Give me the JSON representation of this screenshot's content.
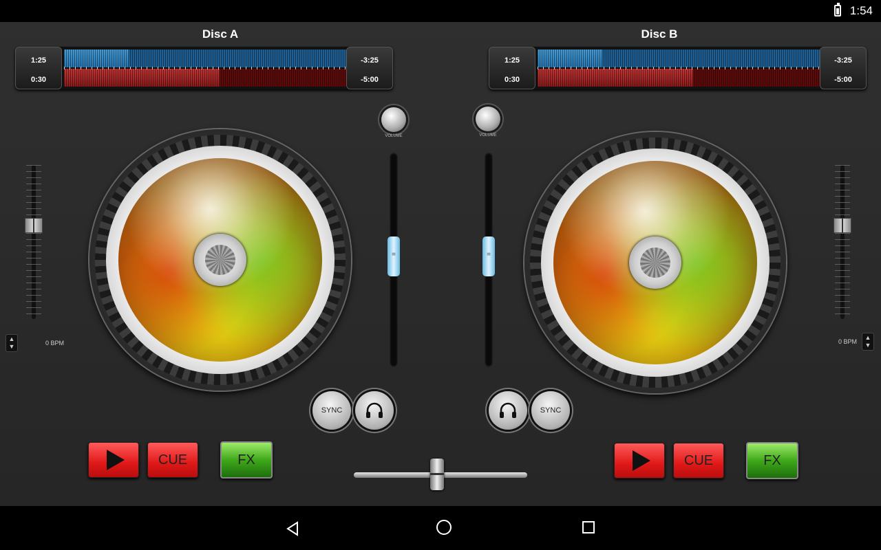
{
  "status_bar": {
    "time": "1:54"
  },
  "decks": [
    {
      "title": "Disc A",
      "elapsed_top": "1:25",
      "elapsed_bottom": "0:30",
      "remaining_top": "-3:25",
      "remaining_bottom": "-5:00",
      "top_wave_progress": 0.23,
      "bottom_wave_progress": 0.55,
      "bpm": "0 BPM",
      "volume_label": "VOLUME",
      "sync_label": "SYNC",
      "cue_label": "CUE",
      "fx_label": "FX",
      "pitch_position": 0.38,
      "channel_fader_position": 0.48
    },
    {
      "title": "Disc B",
      "elapsed_top": "1:25",
      "elapsed_bottom": "0:30",
      "remaining_top": "-3:25",
      "remaining_bottom": "-5:00",
      "top_wave_progress": 0.23,
      "bottom_wave_progress": 0.55,
      "bpm": "0 BPM",
      "volume_label": "VOLUME",
      "sync_label": "SYNC",
      "cue_label": "CUE",
      "fx_label": "FX",
      "pitch_position": 0.38,
      "channel_fader_position": 0.48
    }
  ],
  "crossfader_position": 0.48,
  "colors": {
    "play_red": "#e01818",
    "fx_green": "#3fa81a",
    "fader_blue": "#6bbbe3"
  },
  "icons": {
    "headphones": "headphones-icon",
    "back": "back-icon",
    "home": "home-icon",
    "recents": "recents-icon",
    "battery": "battery-icon"
  }
}
